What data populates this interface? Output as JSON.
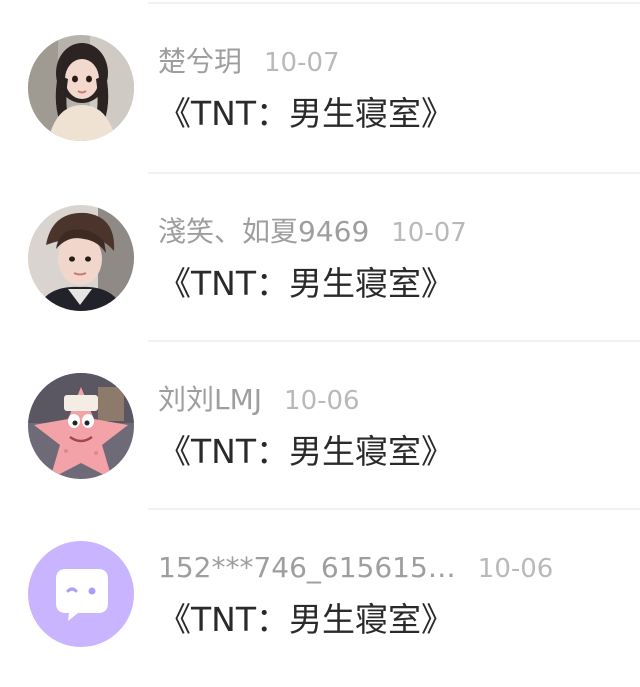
{
  "comments": [
    {
      "username": "楚兮玥",
      "time": "10-07",
      "content": "《TNT：男生寝室》",
      "avatar": "girl-photo-avatar"
    },
    {
      "username": "淺笑、如夏9469",
      "time": "10-07",
      "content": "《TNT：男生寝室》",
      "avatar": "boy-photo-avatar"
    },
    {
      "username": "刘刘LMJ",
      "time": "10-06",
      "content": "《TNT：男生寝室》",
      "avatar": "patrick-star-avatar"
    },
    {
      "username": "152***746_615615…",
      "time": "10-06",
      "content": "《TNT：男生寝室》",
      "avatar": "chat-bubble-icon"
    }
  ],
  "colors": {
    "name": "#9e9e9e",
    "time": "#b9b9b9",
    "content": "#2a2a2a",
    "default_avatar_bg": "#c9b4ff"
  }
}
